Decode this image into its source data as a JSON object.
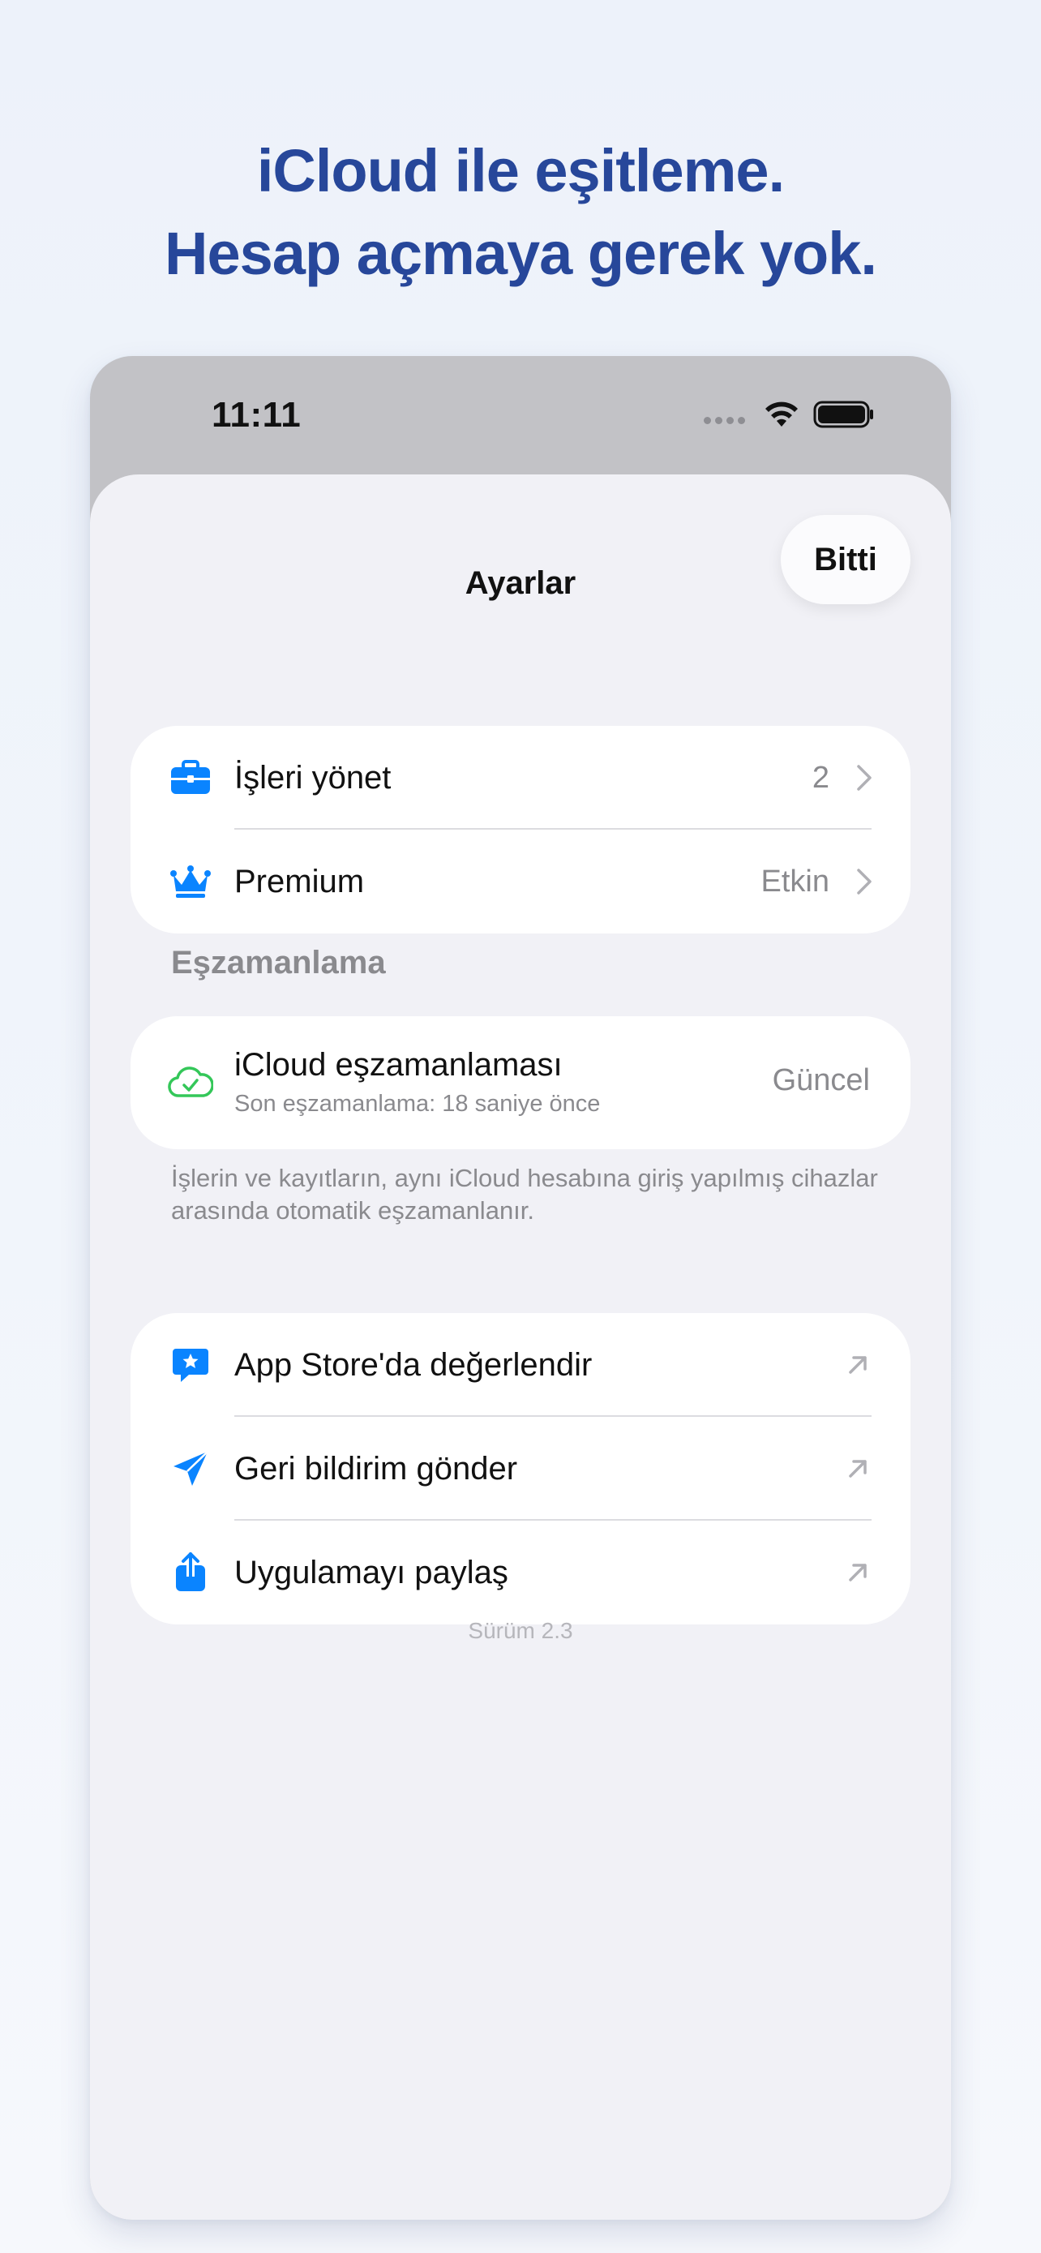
{
  "headline": {
    "line1": "iCloud ile eşitleme.",
    "line2": "Hesap açmaya gerek yok."
  },
  "status_bar": {
    "time": "11:11",
    "icons": [
      "signal-dots-icon",
      "wifi-icon",
      "battery-icon"
    ]
  },
  "sheet": {
    "title": "Ayarlar",
    "done_label": "Bitti"
  },
  "group1": [
    {
      "icon": "briefcase-icon",
      "label": "İşleri yönet",
      "value": "2"
    },
    {
      "icon": "crown-icon",
      "label": "Premium",
      "value": "Etkin"
    }
  ],
  "sync_section": {
    "header": "Eşzamanlama",
    "title": "iCloud eşzamanlaması",
    "subtitle": "Son eşzamanlama: 18 saniye önce",
    "status": "Güncel",
    "footnote": "İşlerin ve kayıtların, aynı iCloud hesabına giriş yapılmış cihazlar arasında otomatik eşzamanlanır."
  },
  "group3": [
    {
      "icon": "star-bubble-icon",
      "label": "App Store'da değerlendir"
    },
    {
      "icon": "paper-plane-icon",
      "label": "Geri bildirim gönder"
    },
    {
      "icon": "share-icon",
      "label": "Uygulamayı paylaş"
    }
  ],
  "version": "Sürüm 2.3",
  "colors": {
    "headline": "#27479a",
    "accent_blue": "#0a84ff",
    "sync_green": "#34c759"
  }
}
